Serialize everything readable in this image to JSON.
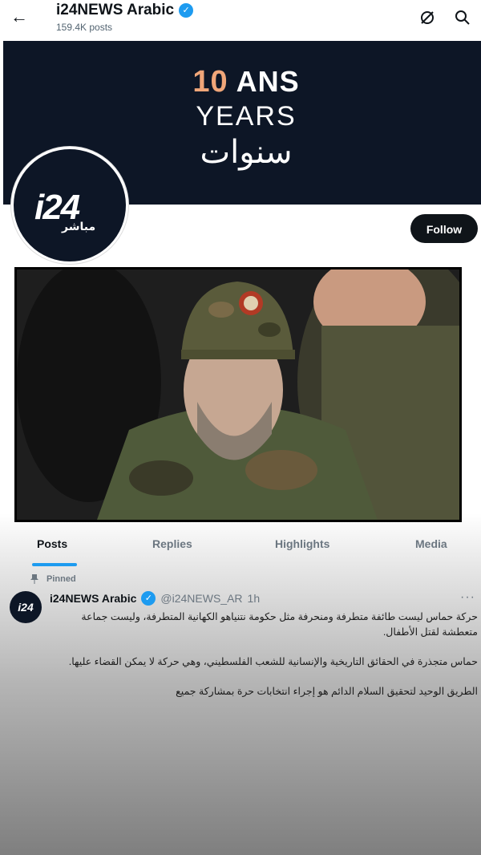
{
  "header": {
    "account_name": "i24NEWS Arabic",
    "posts_count": "159.4K posts"
  },
  "banner": {
    "ten": "10",
    "ans": "ANS",
    "years": "YEARS",
    "arabic": "سنوات"
  },
  "avatar": {
    "logo_text": "i24",
    "sub_text": "مباشر"
  },
  "follow_label": "Follow",
  "tabs": [
    "Posts",
    "Replies",
    "Highlights",
    "Media"
  ],
  "pinned_label": "Pinned",
  "post": {
    "avatar_text": "i24",
    "name": "i24NEWS Arabic",
    "handle": "@i24NEWS_AR",
    "time": "1h",
    "paragraphs": [
      "حركة حماس ليست طائفة متطرفة ومنحرفة مثل حكومة نتنياهو الكهانية المتطرفة، وليست جماعة متعطشة لقتل الأطفال.",
      "حماس متجذرة في الحقائق التاريخية والإنسانية للشعب الفلسطيني، وهي حركة لا يمكن القضاء عليها.",
      "الطريق الوحيد لتحقيق السلام الدائم هو إجراء انتخابات حرة بمشاركة جميع"
    ]
  },
  "colors": {
    "banner_bg": "#0d1626",
    "accent": "#1d9bf0",
    "ten_color": "#f0a679"
  }
}
